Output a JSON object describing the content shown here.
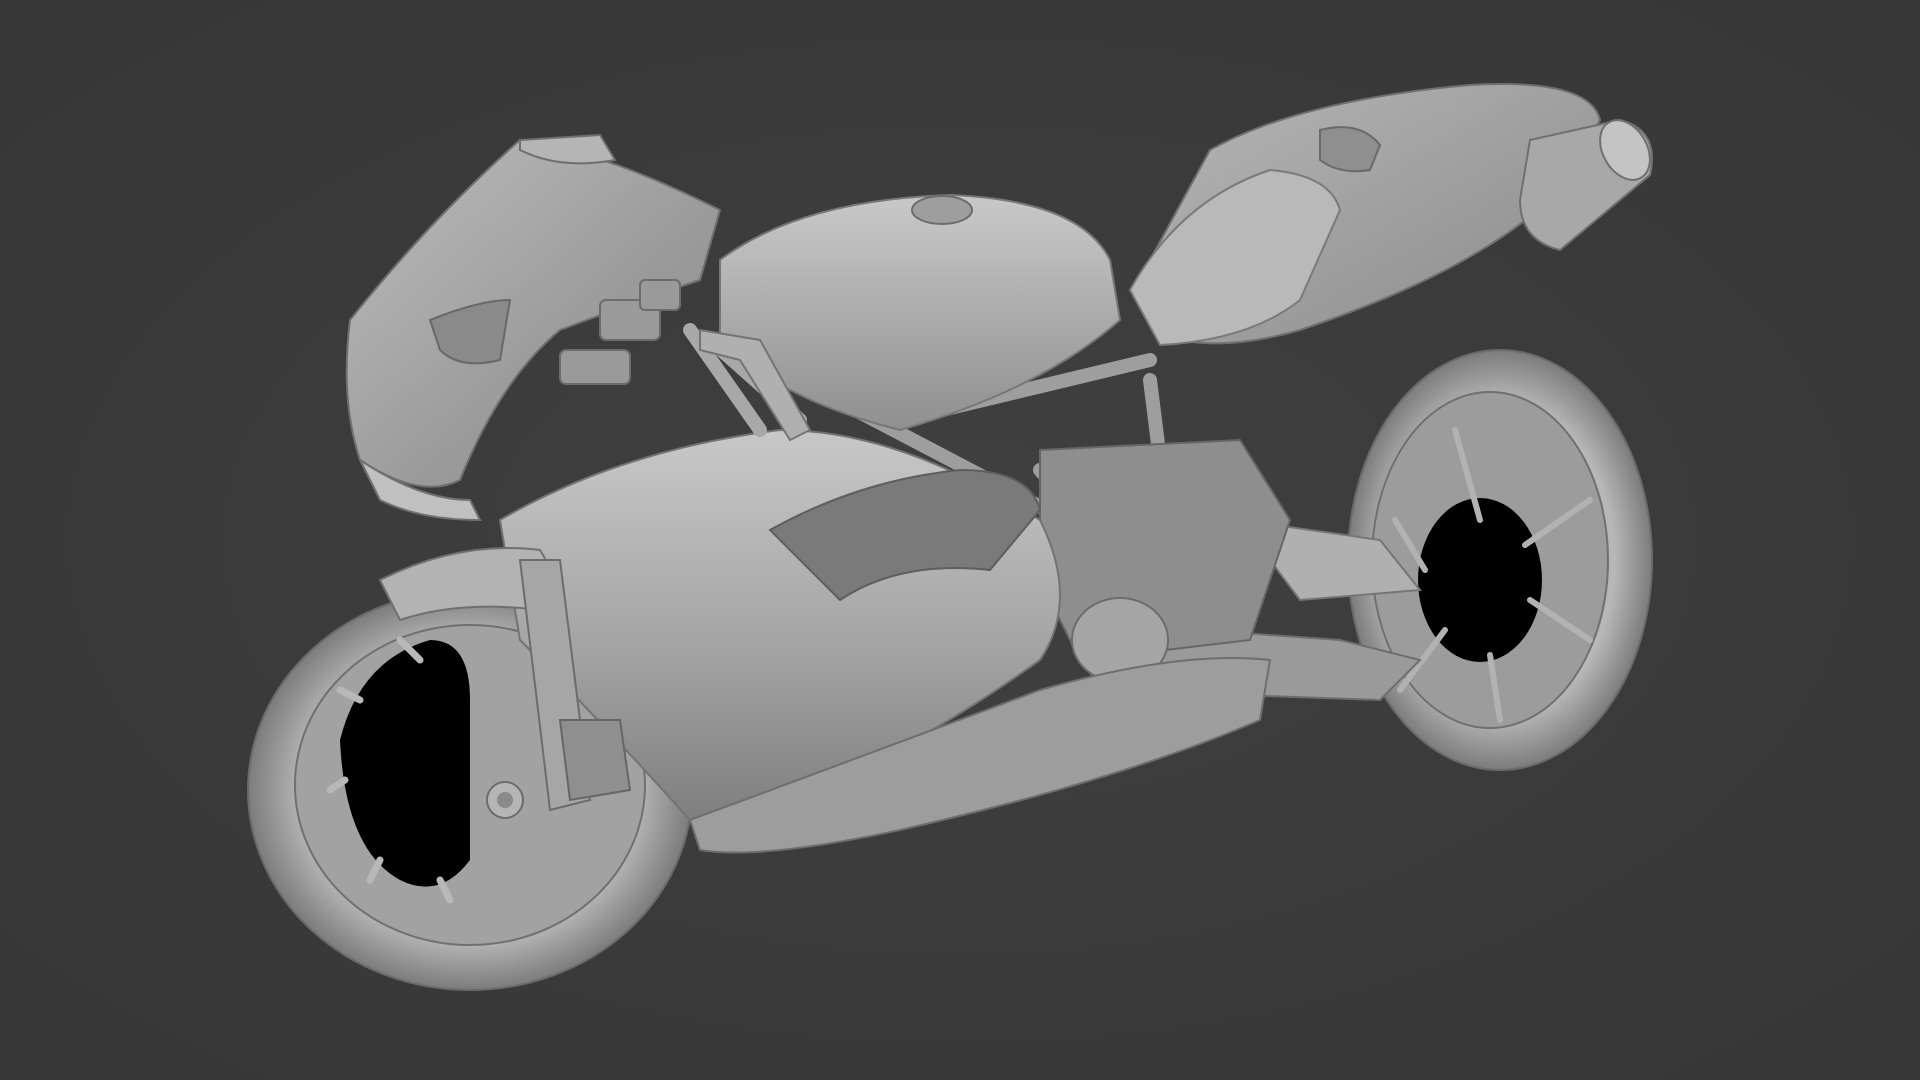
{
  "viewport": {
    "background": "#3b3b3b",
    "model_shade": "#a9a9a9",
    "model_highlight": "#d0d0d0",
    "model_shadow": "#6e6e6e",
    "void": "#000000"
  },
  "model": {
    "name": "",
    "kind": "sport-motorcycle",
    "render_mode": "solid-grey-matcap"
  }
}
